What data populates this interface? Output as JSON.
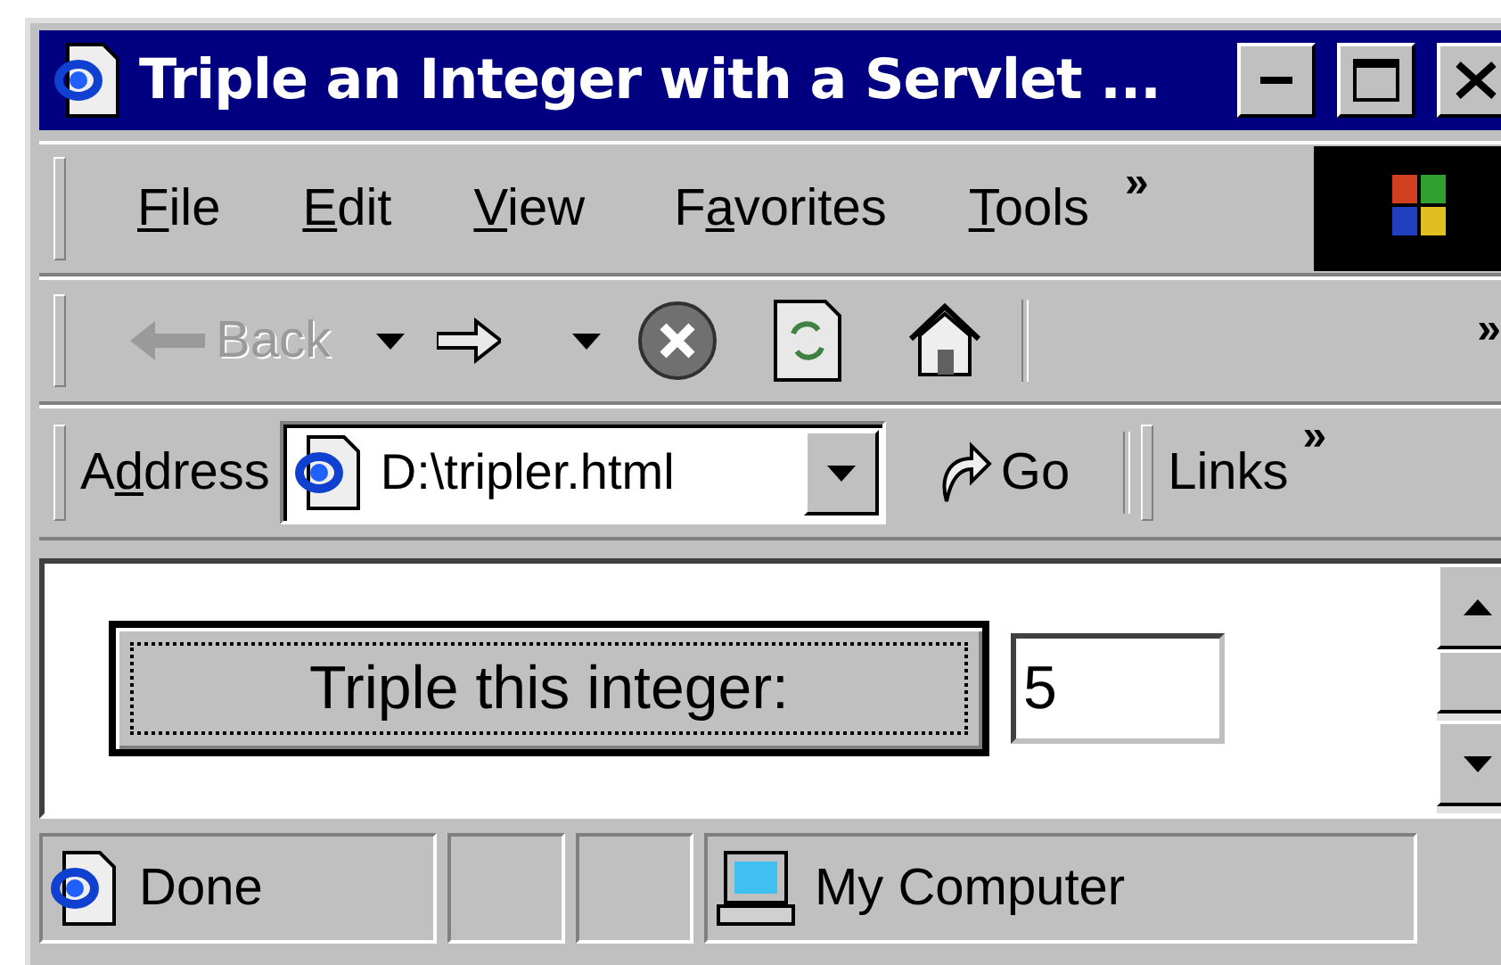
{
  "window": {
    "title": "Triple an Integer with a Servlet ..."
  },
  "menu": [
    {
      "key": "F",
      "post": "ile"
    },
    {
      "key": "E",
      "post": "dit"
    },
    {
      "key": "V",
      "post": "iew"
    },
    {
      "pre": "F",
      "key": "a",
      "post": "vorites"
    },
    {
      "key": "T",
      "post": "ools"
    }
  ],
  "menu_more": "»",
  "toolbar": {
    "back": {
      "label": "Back",
      "disabled": true
    },
    "more": "»"
  },
  "address": {
    "pre": "A",
    "key": "d",
    "post": "dress",
    "value": "D:\\tripler.html",
    "go": "Go",
    "links": "Links",
    "more": "»"
  },
  "form": {
    "button": "Triple this integer:",
    "value": "5"
  },
  "status": {
    "text": "Done",
    "zone": "My Computer"
  }
}
